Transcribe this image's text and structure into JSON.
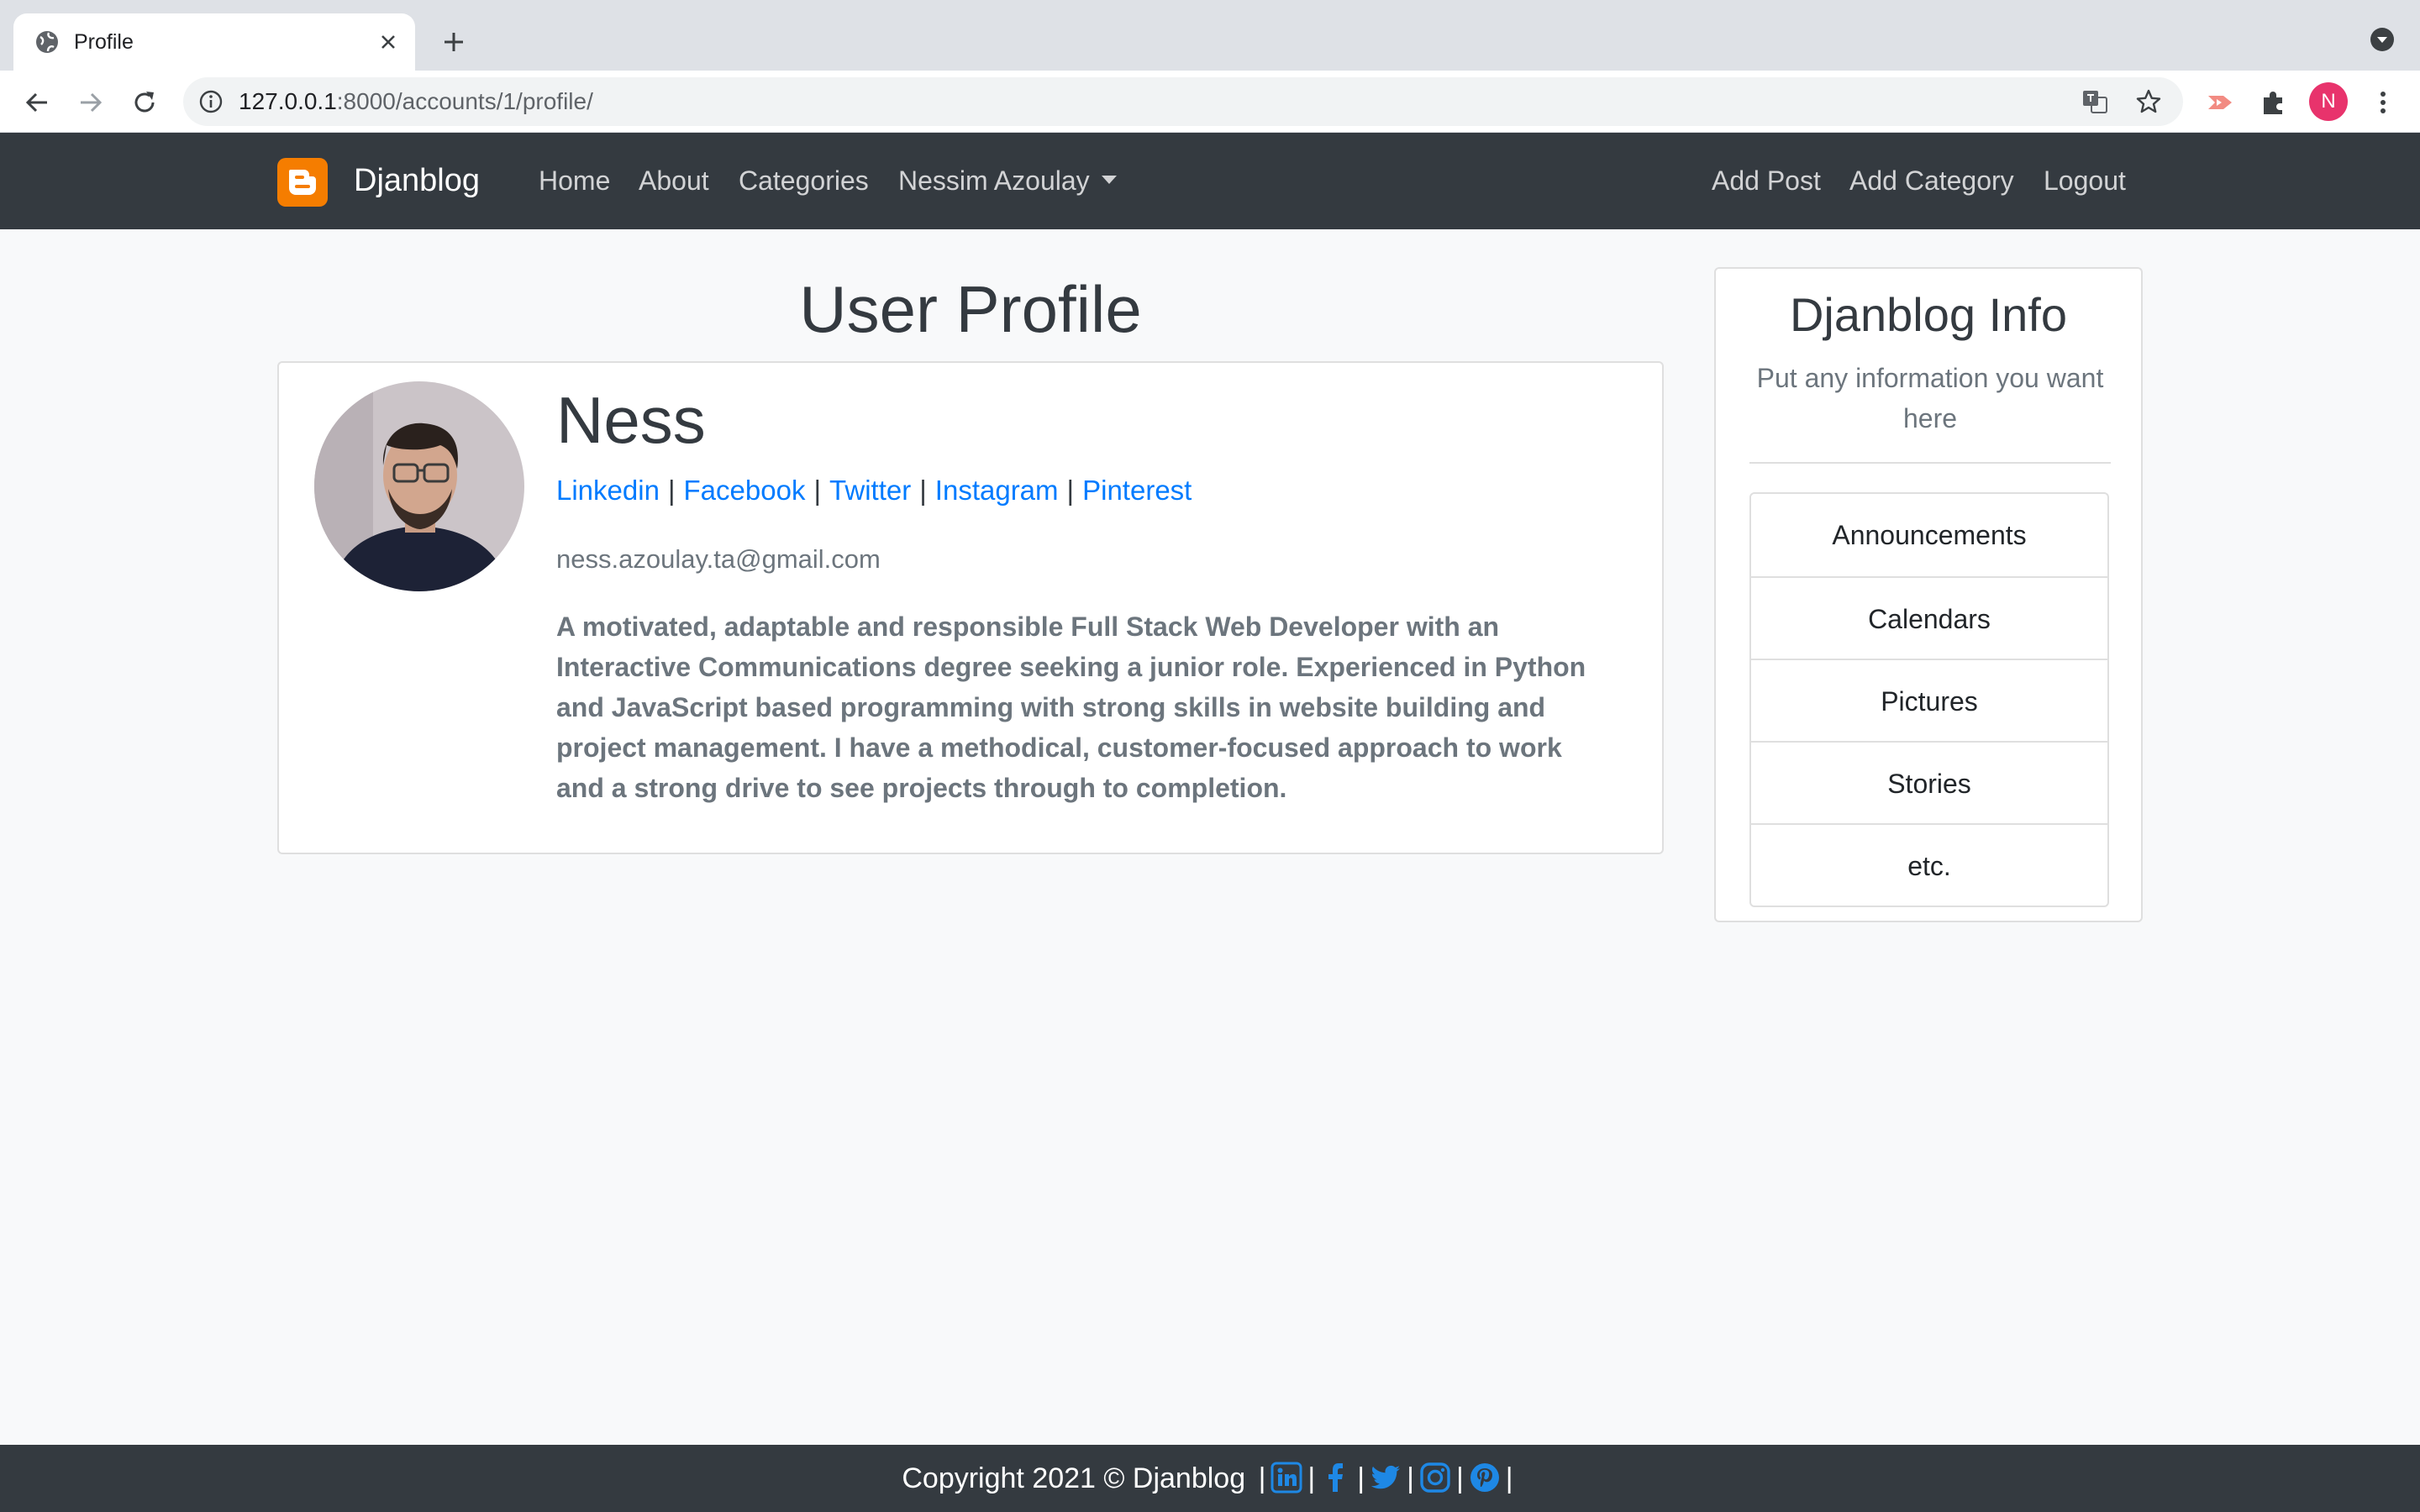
{
  "browser": {
    "tab_title": "Profile",
    "url_host": "127.0.0.1",
    "url_path": ":8000/accounts/1/profile/",
    "profile_initial": "N"
  },
  "navbar": {
    "brand": "Djanblog",
    "links": [
      "Home",
      "About",
      "Categories"
    ],
    "user_menu": "Nessim Azoulay",
    "right_links": [
      "Add Post",
      "Add Category",
      "Logout"
    ],
    "bg_color": "#343a40"
  },
  "main": {
    "title": "User Profile",
    "profile": {
      "name": "Ness",
      "socials": [
        "Linkedin",
        "Facebook",
        "Twitter",
        "Instagram",
        "Pinterest"
      ],
      "separator": "|",
      "email": "ness.azoulay.ta@gmail.com",
      "bio": "A motivated, adaptable and responsible Full Stack Web Developer with an Interactive Communications degree seeking a junior role. Experienced in Python and JavaScript based programming with strong skills in website building and project management. I have a methodical, customer-focused approach to work and a strong drive to see projects through to completion."
    }
  },
  "sidebar": {
    "title": "Djanblog Info",
    "description": "Put any information you want here",
    "items": [
      "Announcements",
      "Calendars",
      "Pictures",
      "Stories",
      "etc."
    ]
  },
  "footer": {
    "copyright": "Copyright 2021 © Djanblog",
    "separator": "|",
    "icons": [
      "linkedin-icon",
      "facebook-icon",
      "twitter-icon",
      "instagram-icon",
      "pinterest-icon"
    ],
    "icon_color": "#007bff"
  }
}
